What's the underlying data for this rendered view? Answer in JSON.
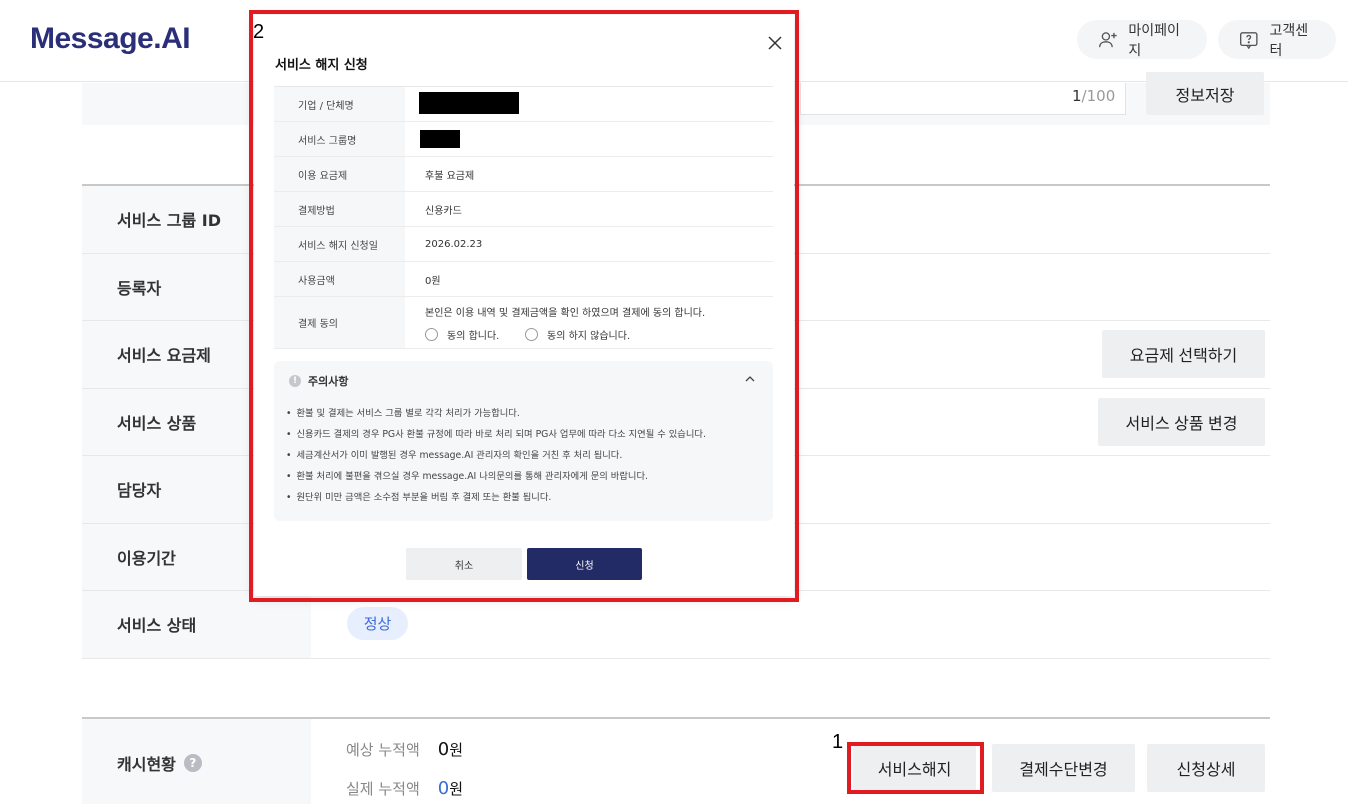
{
  "header": {
    "logo": "Message.AI",
    "mypage_label": "마이페이지",
    "support_label": "고객센터"
  },
  "info_form": {
    "char_counter_current": "1",
    "char_counter_max": "/100",
    "save_label": "정보저장"
  },
  "details": {
    "rows": [
      {
        "label": "서비스 그룹 ID"
      },
      {
        "label": "등록자"
      },
      {
        "label": "서비스 요금제"
      },
      {
        "label": "서비스 상품"
      },
      {
        "label": "담당자"
      },
      {
        "label": "이용기간"
      },
      {
        "label": "서비스 상태"
      }
    ],
    "select_plan_label": "요금제 선택하기",
    "change_product_label": "서비스 상품 변경",
    "status_badge": "정상"
  },
  "cash": {
    "label": "캐시현황",
    "expected_label": "예상 누적액",
    "expected_value": "0",
    "actual_label": "실제 누적액",
    "actual_value": "0",
    "currency": "원",
    "cancel_service_label": "서비스해지",
    "change_payment_label": "결제수단변경",
    "detail_label": "신청상세"
  },
  "annotations": {
    "mark_1": "1",
    "mark_2": "2",
    "color": "#e01b22"
  },
  "modal": {
    "title": "서비스 해지 신청",
    "rows": [
      {
        "label": "기업 / 단체명",
        "value": ""
      },
      {
        "label": "서비스 그룹명",
        "value": ""
      },
      {
        "label": "이용 요금제",
        "value": "후불 요금제"
      },
      {
        "label": "결제방법",
        "value": "신용카드"
      },
      {
        "label": "서비스 해지 신청일",
        "value": "2026.02.23"
      },
      {
        "label": "사용금액",
        "value": "0원"
      }
    ],
    "consent": {
      "label": "결제 동의",
      "text": "본인은 이용 내역 및 결제금액을 확인 하였으며 결제에 동의 합니다.",
      "agree": "동의 합니다.",
      "disagree": "동의 하지 않습니다."
    },
    "notice": {
      "title": "주의사항",
      "items": [
        "환불 및 결제는 서비스 그룹 별로 각각 처리가 가능합니다.",
        "신용카드 결제의 경우 PG사 환불 규정에 따라 바로 처리 되며 PG사 업무에 따라 다소 지연될 수 있습니다.",
        "세금계산서가 이미 발행된 경우 message.AI 관리자의 확인을 거친 후 처리 됩니다.",
        "환불 처리에 불편을 겪으실 경우 message.AI 나의문의를 통해 관리자에게 문의 바랍니다.",
        "원단위 미만 금액은 소수점 부분을 버림 후 결제 또는 환불 됩니다."
      ]
    },
    "cancel_label": "취소",
    "apply_label": "신청",
    "accent": "#232b66"
  }
}
